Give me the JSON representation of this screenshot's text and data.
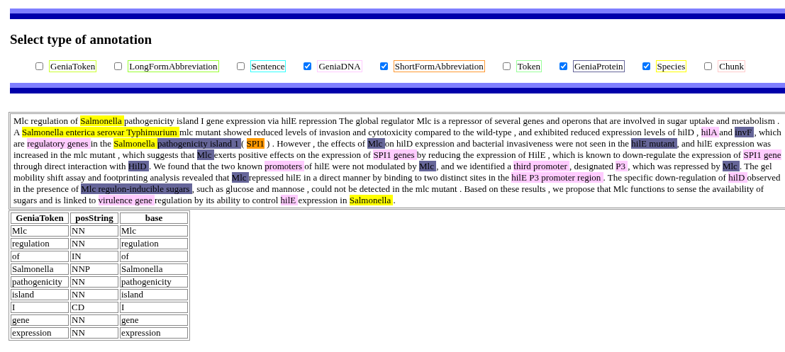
{
  "heading": "Select type of annotation",
  "annotation_types": [
    {
      "label": "GeniaToken",
      "checked": false,
      "color": "#ccff33"
    },
    {
      "label": "LongFormAbbreviation",
      "checked": false,
      "color": "#99ff33"
    },
    {
      "label": "Sentence",
      "checked": false,
      "color": "#33ffff"
    },
    {
      "label": "GeniaDNA",
      "checked": true,
      "color": "#ffccff"
    },
    {
      "label": "ShortFormAbbreviation",
      "checked": true,
      "color": "#ff9933"
    },
    {
      "label": "Token",
      "checked": false,
      "color": "#99ff99"
    },
    {
      "label": "GeniaProtein",
      "checked": true,
      "color": "#666699"
    },
    {
      "label": "Species",
      "checked": true,
      "color": "#ffff00"
    },
    {
      "label": "Chunk",
      "checked": false,
      "color": "#ffcccc"
    }
  ],
  "text_lines": [
    [
      {
        "text": "Mlc regulation of "
      },
      {
        "text": "Salmonella ",
        "color": "#ffff00"
      },
      {
        "text": "pathogenicity island I gene expression via hilE repression The global regulator Mlc is a repressor of several genes and operons that are involved in sugar uptake and metabolism ."
      }
    ],
    [
      {
        "text": "A "
      },
      {
        "text": "Salmonella enterica serovar Typhimurium ",
        "color": "#ffff00"
      },
      {
        "text": "mlc mutant showed reduced levels of invasion and cytotoxicity compared to the wild-type , and exhibited reduced expression levels of hilD , "
      },
      {
        "text": "hilA ",
        "color": "#ffccff"
      },
      {
        "text": "and "
      },
      {
        "text": "invF ",
        "color": "#666699"
      },
      {
        "text": ", which"
      }
    ],
    [
      {
        "text": "are "
      },
      {
        "text": "regulatory genes ",
        "color": "#ffccff"
      },
      {
        "text": "in the "
      },
      {
        "text": "Salmonella ",
        "color": "#ffff00"
      },
      {
        "text": "pathogenicity island 1 ",
        "color": "#666699"
      },
      {
        "text": "( "
      },
      {
        "text": "SPI1",
        "color": "#ff9900"
      },
      {
        "text": " ) . However , the effects of "
      },
      {
        "text": "Mlc ",
        "color": "#666699"
      },
      {
        "text": "on hilD expression and bacterial invasiveness were not seen in the "
      },
      {
        "text": "hilE mutant ",
        "color": "#666699"
      },
      {
        "text": ", and hilE expression was"
      }
    ],
    [
      {
        "text": "increased in the mlc mutant , which suggests that "
      },
      {
        "text": "Mlc ",
        "color": "#666699"
      },
      {
        "text": "exerts positive effects on the expression of "
      },
      {
        "text": "SPI1 genes ",
        "color": "#ffccff"
      },
      {
        "text": "by reducing the expression of HilE , which is known to down-regulate the expression of "
      },
      {
        "text": "SPI1 gene",
        "color": "#ffccff"
      }
    ],
    [
      {
        "text": "through direct interaction with "
      },
      {
        "text": "HilD ",
        "color": "#666699"
      },
      {
        "text": ". We found that the two known "
      },
      {
        "text": "promoters ",
        "color": "#ffccff"
      },
      {
        "text": "of hilE were not modulated by "
      },
      {
        "text": "Mlc ",
        "color": "#666699"
      },
      {
        "text": ", and we identified a "
      },
      {
        "text": "third promoter ",
        "color": "#ffccff"
      },
      {
        "text": ", designated "
      },
      {
        "text": "P3 ",
        "color": "#ffccff"
      },
      {
        "text": ", which was repressed by "
      },
      {
        "text": "Mlc ",
        "color": "#666699"
      },
      {
        "text": ". The gel"
      }
    ],
    [
      {
        "text": "mobility shift assay and footprinting analysis revealed that "
      },
      {
        "text": "Mlc ",
        "color": "#666699"
      },
      {
        "text": "repressed hilE in a direct manner by binding to two distinct sites in the "
      },
      {
        "text": "hilE P3 promoter region ",
        "color": "#ffccff"
      },
      {
        "text": ". The specific down-regulation of "
      },
      {
        "text": "hilD ",
        "color": "#ffccff"
      },
      {
        "text": "observed"
      }
    ],
    [
      {
        "text": "in the presence of "
      },
      {
        "text": "Mlc regulon-inducible sugars ",
        "color": "#666699"
      },
      {
        "text": ", such as glucose and mannose , could not be detected in the mlc mutant . Based on these results , we propose that Mlc functions to sense the availability of"
      }
    ],
    [
      {
        "text": "sugars and is linked to "
      },
      {
        "text": "virulence gene ",
        "color": "#ffccff"
      },
      {
        "text": "regulation by its ability to control "
      },
      {
        "text": "hilE ",
        "color": "#ffccff"
      },
      {
        "text": "expression in "
      },
      {
        "text": "Salmonella ",
        "color": "#ffff00"
      },
      {
        "text": "."
      }
    ]
  ],
  "table": {
    "columns": [
      "GeniaToken",
      "posString",
      "base"
    ],
    "rows": [
      [
        "Mlc",
        "NN",
        "Mlc"
      ],
      [
        "regulation",
        "NN",
        "regulation"
      ],
      [
        "of",
        "IN",
        "of"
      ],
      [
        "Salmonella",
        "NNP",
        "Salmonella"
      ],
      [
        "pathogenicity",
        "NN",
        "pathogenicity"
      ],
      [
        "island",
        "NN",
        "island"
      ],
      [
        "I",
        "CD",
        "I"
      ],
      [
        "gene",
        "NN",
        "gene"
      ],
      [
        "expression",
        "NN",
        "expression"
      ]
    ]
  }
}
